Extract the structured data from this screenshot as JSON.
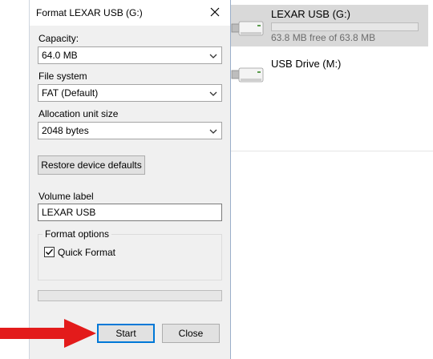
{
  "explorer": {
    "drives": [
      {
        "name": "LEXAR USB (G:)",
        "free_text": "63.8 MB free of 63.8 MB",
        "used_fraction": 0.0,
        "selected": true
      },
      {
        "name": "USB Drive (M:)",
        "selected": false
      }
    ]
  },
  "dialog": {
    "title": "Format LEXAR USB (G:)",
    "capacity": {
      "label": "Capacity:",
      "value": "64.0 MB"
    },
    "file_system": {
      "label": "File system",
      "value": "FAT (Default)"
    },
    "allocation": {
      "label": "Allocation unit size",
      "value": "2048 bytes"
    },
    "restore_label": "Restore device defaults",
    "volume_label": {
      "label": "Volume label",
      "value": "LEXAR USB"
    },
    "format_options": {
      "legend": "Format options",
      "quick_format_label": "Quick Format",
      "quick_format_checked": true
    },
    "progress_fraction": 0.0,
    "start_label": "Start",
    "close_label": "Close"
  },
  "annotation": {
    "arrow_color": "#e31b1b"
  },
  "colors": {
    "accent": "#0078d7",
    "selection": "#d9d9d9"
  }
}
